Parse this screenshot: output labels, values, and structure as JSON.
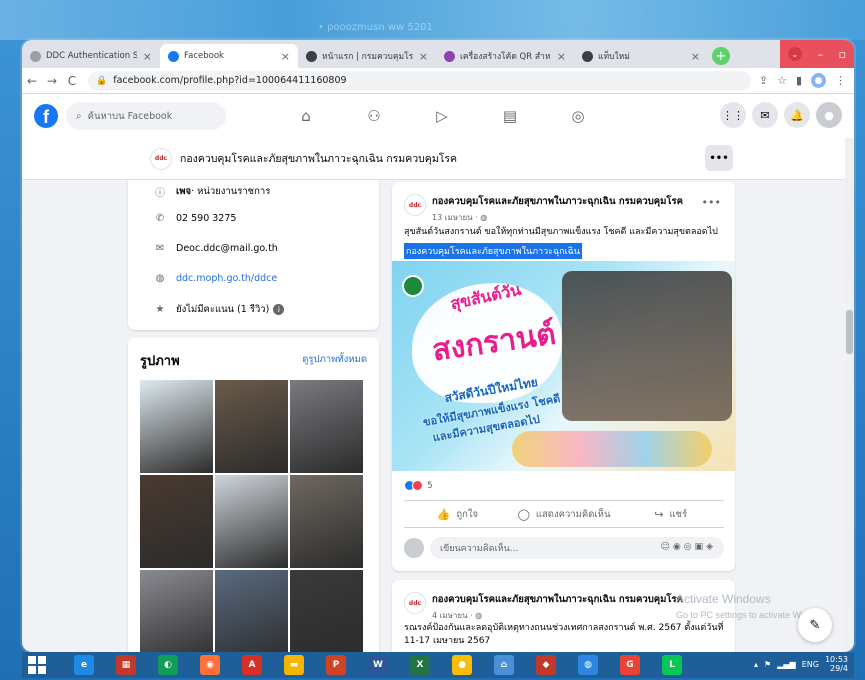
{
  "blurred_top_text": "• ρooozmusn ww 5201",
  "browser": {
    "tabs": [
      {
        "label": "DDC Authentication Services",
        "icon": "globe-icon",
        "color": "#9aa0a6",
        "active": false
      },
      {
        "label": "Facebook",
        "icon": "facebook-icon",
        "color": "#1877f2",
        "active": true
      },
      {
        "label": "หน้าแรก | กรมควบคุมโรค",
        "icon": "globe-icon",
        "color": "#3c4043",
        "active": false
      },
      {
        "label": "เครื่องสร้างโค้ด QR สำหรับลิงก์ | แปลง",
        "icon": "qr-icon",
        "color": "#8e44ad",
        "active": false
      },
      {
        "label": "แท็บใหม่",
        "icon": "chrome-icon",
        "color": "#3c4043",
        "active": false
      }
    ],
    "url": "facebook.com/profile.php?id=100064411160809"
  },
  "facebook": {
    "search_placeholder": "ค้นหาบน Facebook",
    "page_name": "กองควบคุมโรคและภัยสุขภาพในภาวะฉุกเฉิน กรมควบคุมโรค",
    "page_logo_text": "ddc",
    "more_label": "•••"
  },
  "intro": {
    "category_bold": "เพจ",
    "category_rest": " · หน่วยงานราชการ",
    "phone": "02 590 3275",
    "email": "Deoc.ddc@mail.go.th",
    "website": "ddc.moph.go.th/ddce",
    "rating": "ยังไม่มีคะแนน (1 รีวิว)"
  },
  "photos": {
    "title": "รูปภาพ",
    "see_all": "ดูรูปภาพทั้งหมด",
    "tiles": [
      "#dfeaf0",
      "#6b5a4a",
      "#7a7a80",
      "#4a3a30",
      "#cfd6dc",
      "#6f6860",
      "#8a8a92",
      "#5a6a80",
      "#3a3a3a"
    ]
  },
  "post1": {
    "author": "กองควบคุมโรคและภัยสุขภาพในภาวะฉุกเฉิน กรมควบคุมโรค",
    "date": "13 เมษายน · ",
    "text": "สุขสันต์วันสงกรานต์ ขอให้ทุกท่านมีสุขภาพแข็งแรง โชคดี และมีความสุขตลอดไป",
    "highlight": "กองควบคุมโรคและภัยสุขภาพในภาวะฉุกเฉิน",
    "image_text": {
      "line1": "สุขสันต์วัน",
      "line2": "สงกรานต์",
      "line3": "สวัสดีวันปีใหม่ไทย",
      "line4": "ขอให้มีสุขภาพแข็งแรง โชคดี",
      "line5": "และมีความสุขตลอดไป"
    },
    "reactions_count": "5",
    "like_label": "ถูกใจ",
    "comment_label": "แสดงความคิดเห็น",
    "share_label": "แชร์",
    "comment_placeholder": "เขียนความคิดเห็น..."
  },
  "post2": {
    "author": "กองควบคุมโรคและภัยสุขภาพในภาวะฉุกเฉิน กรมควบคุมโรค",
    "date": "4 เมษายน · ",
    "text": "รณรงค์ป้องกันและลดอุบัติเหตุทางถนนช่วงเทศกาลสงกรานต์ พ.ศ. 2567 ตั้งแต่วันที่ 11-17 เมษายน 2567"
  },
  "watermark": {
    "line1": "Activate Windows",
    "line2": "Go to PC settings to activate Windows."
  },
  "taskbar": {
    "apps": [
      {
        "icon": "ie-icon",
        "color": "#1e88e5",
        "label": "e"
      },
      {
        "icon": "gallery-icon",
        "color": "#c0392b",
        "label": "▦"
      },
      {
        "icon": "edge-icon",
        "color": "#0f9d58",
        "label": "◐"
      },
      {
        "icon": "firefox-icon",
        "color": "#ff7139",
        "label": "◉"
      },
      {
        "icon": "acrobat-icon",
        "color": "#d93025",
        "label": "A"
      },
      {
        "icon": "folder-icon",
        "color": "#f4b400",
        "label": "▬"
      },
      {
        "icon": "powerpoint-icon",
        "color": "#d04423",
        "label": "P"
      },
      {
        "icon": "word-icon",
        "color": "#2b579a",
        "label": "W"
      },
      {
        "icon": "excel-icon",
        "color": "#217346",
        "label": "X"
      },
      {
        "icon": "chrome-icon",
        "color": "#fbbc05",
        "label": "●"
      },
      {
        "icon": "network-icon",
        "color": "#4a90d9",
        "label": "⌂"
      },
      {
        "icon": "shield-app-icon",
        "color": "#c0392b",
        "label": "◆"
      },
      {
        "icon": "globe-app-icon",
        "color": "#2e86de",
        "label": "◍"
      },
      {
        "icon": "chrome-app-icon",
        "color": "#ea4335",
        "label": "G"
      },
      {
        "icon": "line-icon",
        "color": "#06c755",
        "label": "L"
      }
    ],
    "lang": "ENG",
    "time": "10:53",
    "date": "29/4"
  }
}
